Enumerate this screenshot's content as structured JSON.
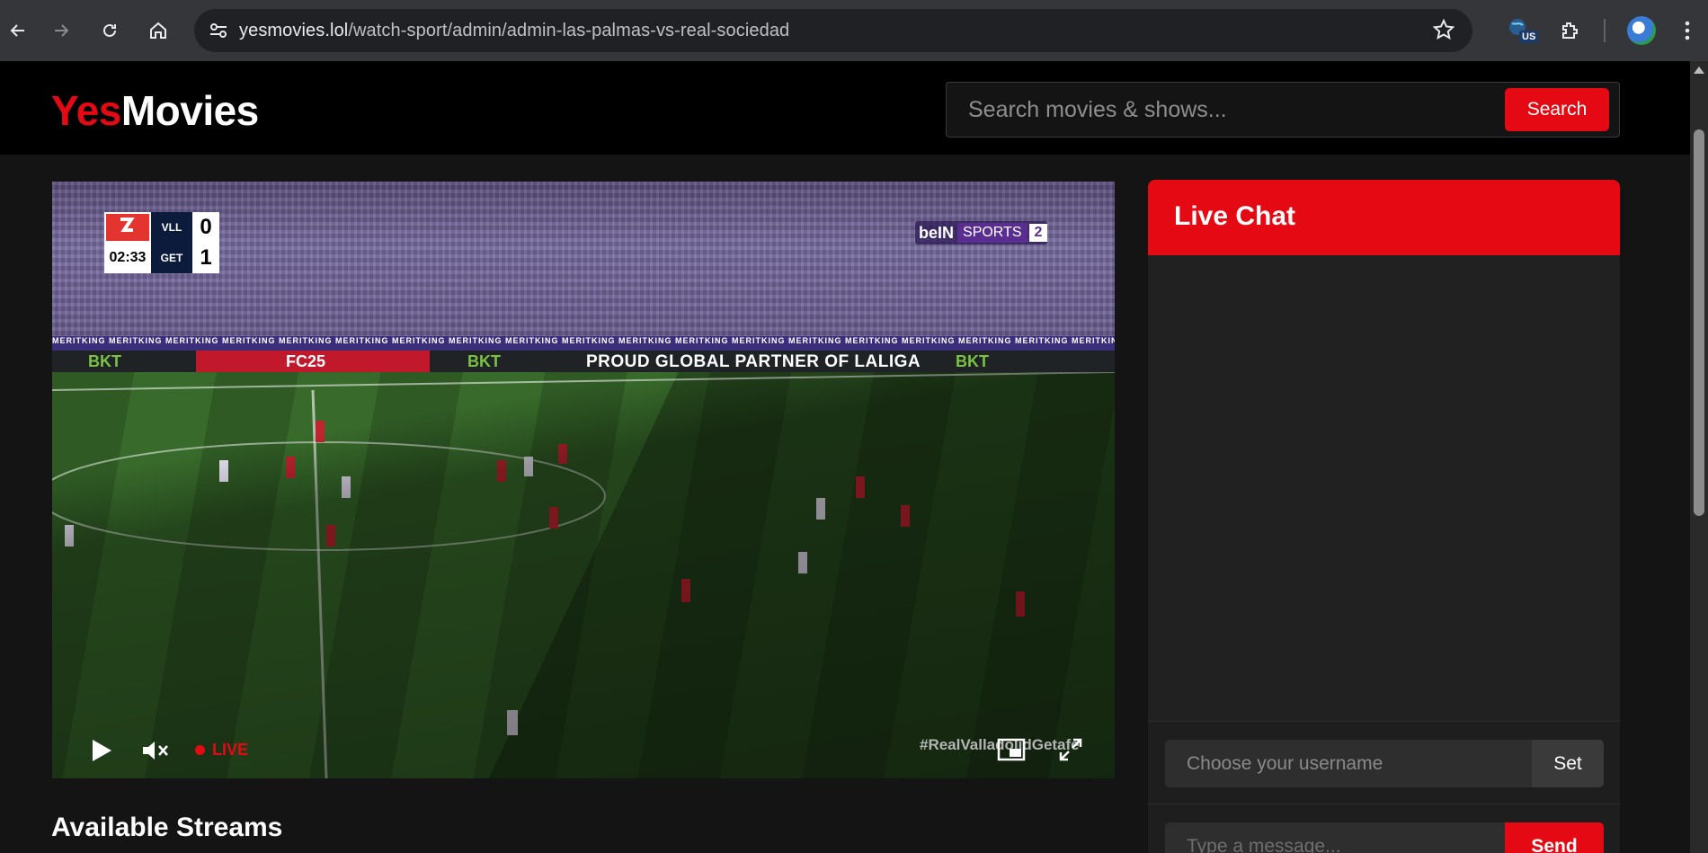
{
  "browser": {
    "url_host": "yesmovies.lol",
    "url_path": "/watch-sport/admin/admin-las-palmas-vs-real-sociedad",
    "extension_badge": "US"
  },
  "header": {
    "logo_part1": "Yes",
    "logo_part2": "Movies",
    "search_placeholder": "Search movies & shows...",
    "search_button": "Search"
  },
  "video": {
    "scorebug": {
      "time": "02:33",
      "team_home": "VLL",
      "team_away": "GET",
      "score_home": "0",
      "score_away": "1"
    },
    "channel": {
      "brand": "beIN",
      "sports": "SPORTS",
      "number": "2"
    },
    "board_text": "PROUD GLOBAL PARTNER OF LALIGA",
    "board_sponsor": "BKT",
    "board_game": "FC25",
    "hashtag": "#RealValladolidGetafe",
    "live_label": "LIVE",
    "live_color": "#e50914"
  },
  "chat": {
    "title": "Live Chat",
    "username_placeholder": "Choose your username",
    "set_button": "Set",
    "message_placeholder": "Type a message...",
    "send_button": "Send"
  },
  "streams": {
    "title": "Available Streams"
  },
  "colors": {
    "accent": "#e50914",
    "background": "#141414",
    "header": "#000000"
  }
}
